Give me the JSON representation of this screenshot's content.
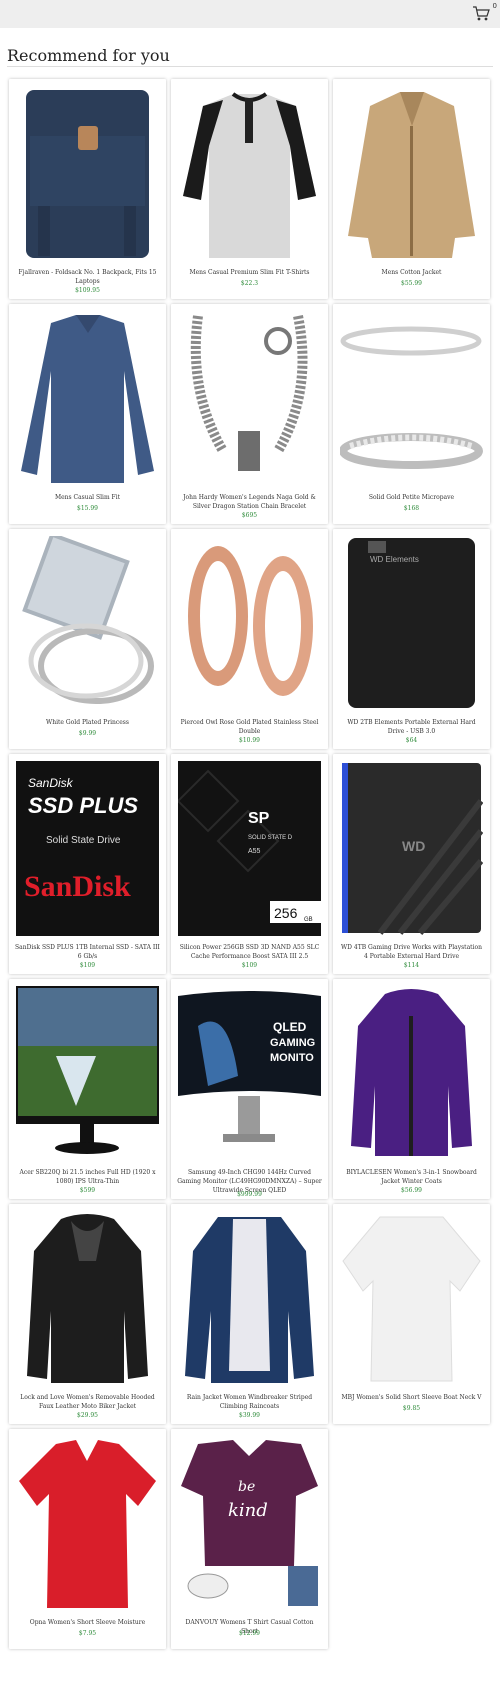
{
  "header": {
    "cart_count": "0"
  },
  "section_title": "Recommend for you",
  "products": [
    {
      "name": "Fjallraven - Foldsack No. 1 Backpack, Fits 15 Laptops",
      "price": "$109.95"
    },
    {
      "name": "Mens Casual Premium Slim Fit T-Shirts",
      "price": "$22.3"
    },
    {
      "name": "Mens Cotton Jacket",
      "price": "$55.99"
    },
    {
      "name": "Mens Casual Slim Fit",
      "price": "$15.99"
    },
    {
      "name": "John Hardy Women's Legends Naga Gold & Silver Dragon Station Chain Bracelet",
      "price": "$695"
    },
    {
      "name": "Solid Gold Petite Micropave",
      "price": "$168"
    },
    {
      "name": "White Gold Plated Princess",
      "price": "$9.99"
    },
    {
      "name": "Pierced Owl Rose Gold Plated Stainless Steel Double",
      "price": "$10.99"
    },
    {
      "name": "WD 2TB Elements Portable External Hard Drive - USB 3.0",
      "price": "$64"
    },
    {
      "name": "SanDisk SSD PLUS 1TB Internal SSD - SATA III 6 Gb/s",
      "price": "$109"
    },
    {
      "name": "Silicon Power 256GB SSD 3D NAND A55 SLC Cache Performance Boost SATA III 2.5",
      "price": "$109"
    },
    {
      "name": "WD 4TB Gaming Drive Works with Playstation 4 Portable External Hard Drive",
      "price": "$114"
    },
    {
      "name": "Acer SB220Q bi 21.5 inches Full HD (1920 x 1080) IPS Ultra-Thin",
      "price": "$599"
    },
    {
      "name": "Samsung 49-Inch CHG90 144Hz Curved Gaming Monitor (LC49HG90DMNXZA) – Super Ultrawide Screen QLED",
      "price": "$999.99"
    },
    {
      "name": "BIYLACLESEN Women's 3-in-1 Snowboard Jacket Winter Coats",
      "price": "$56.99"
    },
    {
      "name": "Lock and Love Women's Removable Hooded Faux Leather Moto Biker Jacket",
      "price": "$29.95"
    },
    {
      "name": "Rain Jacket Women Windbreaker Striped Climbing Raincoats",
      "price": "$39.99"
    },
    {
      "name": "MBJ Women's Solid Short Sleeve Boat Neck V",
      "price": "$9.85"
    },
    {
      "name": "Opna Women's Short Sleeve Moisture",
      "price": "$7.95"
    },
    {
      "name": "DANVOUY Womens T Shirt Casual Cotton Short",
      "price": "$12.99"
    }
  ],
  "image_text": {
    "wd_elements": "WD Elements",
    "sandisk_line1": "SanDisk",
    "sandisk_line2": "SSD PLUS",
    "sandisk_line3": "Solid State Drive",
    "sandisk_brand": "SanDisk",
    "sp_logo": "SP",
    "sp_line": "SOLID STATE D",
    "sp_model": "A55",
    "sp_cap": "256",
    "sp_unit": "GB",
    "wd_logo": "WD",
    "qled1": "QLED",
    "qled2": "GAMING",
    "qled3": "MONITO",
    "bekind1": "be",
    "bekind2": "kind"
  },
  "colors": {
    "price": "#2e8b3a",
    "topbar": "#eeeeee"
  }
}
